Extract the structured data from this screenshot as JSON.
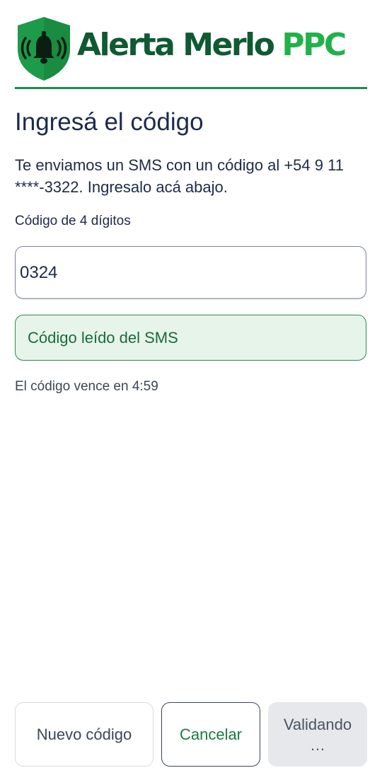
{
  "header": {
    "brand_main": "Alerta Merlo",
    "brand_accent": "PPC",
    "logo_icon": "shield-alarm-bell-icon",
    "colors": {
      "brand_dark": "#0f5a33",
      "brand_light": "#21b14b",
      "divider": "#1d8a4a"
    }
  },
  "main": {
    "title": "Ingresá el código",
    "message": "Te enviamos un SMS con un código al +54 9 11 ****-3322. Ingresalo acá abajo.",
    "code_field": {
      "label": "Código de 4 dígitos",
      "value": "0324"
    },
    "sms_status": "Código leído del SMS",
    "expiry": "El código vence en 4:59"
  },
  "actions": {
    "new_code": "Nuevo código",
    "cancel": "Cancelar",
    "validate": "Validando …"
  }
}
